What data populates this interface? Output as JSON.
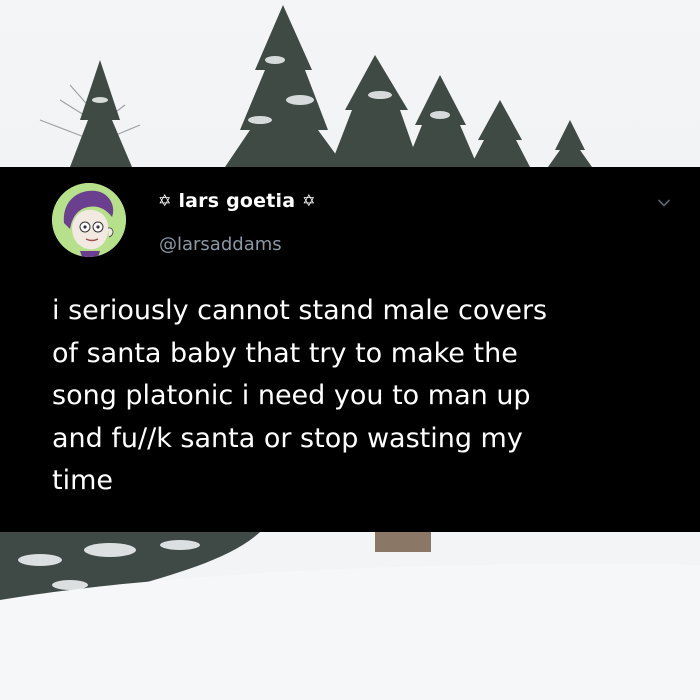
{
  "tweet": {
    "display_name": "lars goetia",
    "name_decoration_left": "✡",
    "name_decoration_right": "✡",
    "handle": "@larsaddams",
    "body_lines": [
      "i seriously cannot stand male covers",
      "of santa baby that try to make the",
      "song platonic i need you to man up",
      "and fu∕∕k santa or stop wasting my",
      "time"
    ]
  },
  "icons": {
    "avatar": "cartoon-avatar-icon",
    "chevron": "chevron-down-icon",
    "decoration": "pentagram-icon"
  },
  "colors": {
    "tweet_background": "#000000",
    "text": "#ffffff",
    "handle": "#8b98a5",
    "avatar_background": "#b7e08b",
    "avatar_hair": "#6b3f8f"
  }
}
